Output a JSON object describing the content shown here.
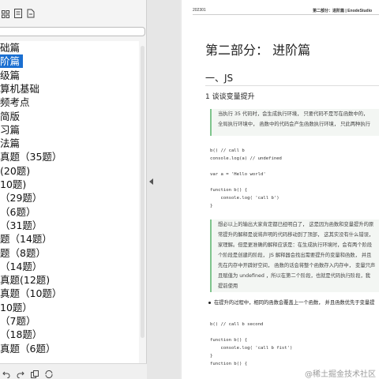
{
  "sidebar": {
    "outline_items": [
      {
        "label": "础篇",
        "selected": false
      },
      {
        "label": "阶篇",
        "selected": true
      },
      {
        "label": "级篇",
        "selected": false
      },
      {
        "label": "算机基础",
        "selected": false
      },
      {
        "label": "频考点",
        "selected": false
      },
      {
        "label": "简版",
        "selected": false
      },
      {
        "label": "习篇",
        "selected": false
      },
      {
        "label": "法篇",
        "selected": false
      },
      {
        "label": "真题（35题）",
        "selected": false
      },
      {
        "label": "(20题)",
        "selected": false
      },
      {
        "label": "10题)",
        "selected": false
      },
      {
        "label": "（29题）",
        "selected": false
      },
      {
        "label": "（6题）",
        "selected": false
      },
      {
        "label": "（31题）",
        "selected": false
      },
      {
        "label": "题（14题）",
        "selected": false
      },
      {
        "label": "题（8题）",
        "selected": false
      },
      {
        "label": "（14题）",
        "selected": false
      },
      {
        "label": "真题(12题)",
        "selected": false
      },
      {
        "label": "真题（10题）",
        "selected": false
      },
      {
        "label": "10题）",
        "selected": false
      },
      {
        "label": "（7题）",
        "selected": false
      },
      {
        "label": "（18题）",
        "selected": false
      },
      {
        "label": "真题（6题）",
        "selected": false
      }
    ]
  },
  "page": {
    "header_left": "202301",
    "header_right": "第二部分：进阶篇 | EnodeStudio",
    "title": "第二部分：  进阶篇",
    "section": "一、JS",
    "subsection": "1 谈谈变量提升",
    "quote1": [
      "当执行 35 代码时，会生成执行环境，  只要代码不是写在函数中的，",
      "全局执行环境中，  函数中的代码会产生函数执行环境，  只此两种执行"
    ],
    "code1": [
      "b() // call b",
      "console.log(a) // undefined",
      "",
      "var a = 'Hello world'",
      "",
      "function b() {",
      "    console.log( 'call b')",
      "}"
    ],
    "quote2": [
      "想必以上的输出大家肯定都已经明白了，  这是因为函数和变量提升的原",
      "常提升的解释是说将声明的代码移动到了顶部，  这其实没有什么错误，",
      "家理解。但是更准确的解释应该是：在生成执行环境时，会有两个阶段",
      "个阶段是创建的阶段，  JS 解释器会找出需要提升的变量和函数，  并且",
      "先在内存中开辟好空间，  函数的话会将整个函数存入内存中，  变量只声",
      "且赋值为 undefined ，所以在第二个阶段，也就是代码执行阶段，我",
      "提前使用"
    ],
    "bullet": "在提升的过程中，相同的函数会覆盖上一个函数，  并且函数优先于变量提",
    "code2": [
      "b() // call b second",
      "",
      "function b() {",
      "    console.log( 'call b fist')",
      "}",
      "function b() {"
    ]
  },
  "watermark": "@稀土掘金技术社区",
  "icons": {
    "toolbar": [
      "grid-view-icon",
      "bookmark-list-icon",
      "export-icon"
    ],
    "bottom": [
      "undo-icon",
      "redo-icon",
      "copy-icon",
      "sync-icon"
    ],
    "splitter": "collapse-left-icon"
  },
  "colors": {
    "selection": "#1a6fd1",
    "quote_border": "#7fc58d",
    "quote_bg": "#f3f6f3",
    "number_highlight": "#e0603a",
    "keyword": "#2d77c9",
    "comment": "#2d8f5f"
  }
}
